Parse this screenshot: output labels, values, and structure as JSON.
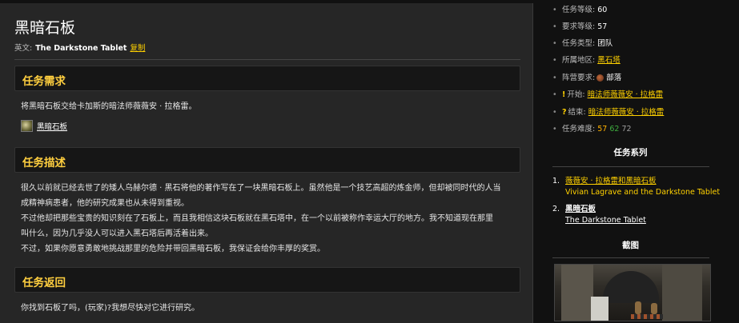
{
  "main": {
    "title": "黑暗石板",
    "en_label": "英文:",
    "en_name": "The Darkstone Tablet",
    "copy_label": "复制",
    "sections": {
      "requirements": {
        "heading": "任务需求",
        "text": "将黑暗石板交给卡加斯的暗法师薇薇安 · 拉格雷。",
        "item_label": "黑暗石板"
      },
      "description": {
        "heading": "任务描述",
        "lines": [
          "很久以前就已经去世了的矮人乌赫尔德 · 黑石将他的著作写在了一块黑暗石板上。虽然他是一个技艺高超的炼金师，但却被同时代的人当",
          "成精神病患者，他的研究成果也从未得到重视。",
          "不过他却把那些宝贵的知识刻在了石板上，而且我相信这块石板就在黑石塔中，在一个以前被称作幸运大厅的地方。我不知道现在那里",
          "叫什么，因为几乎没人可以进入黑石塔后再活着出来。",
          "不过，如果你愿意勇敢地挑战那里的危险并带回黑暗石板，我保证会给你丰厚的奖赏。"
        ]
      },
      "return": {
        "heading": "任务返回",
        "text": "你找到石板了吗，(玩家)?我想尽快对它进行研究。"
      }
    }
  },
  "sidebar": {
    "info": [
      {
        "label": "任务等级:",
        "value": "60"
      },
      {
        "label": "要求等级:",
        "value": "57"
      },
      {
        "label": "任务类型:",
        "value": "团队"
      },
      {
        "label": "所属地区:",
        "value": "黑石塔"
      },
      {
        "label": "阵营要求:",
        "value": "部落"
      },
      {
        "label": "开始:",
        "value": "暗法师薇薇安 · 拉格雷"
      },
      {
        "label": "结束:",
        "value": "暗法师薇薇安 · 拉格雷"
      },
      {
        "label": "任务难度:",
        "d1": "57",
        "d2": "62",
        "d3": "72"
      }
    ],
    "series_heading": "任务系列",
    "series": [
      {
        "num": "1.",
        "cn": "薇薇安 · 拉格雷和黑暗石板",
        "en": "Vivian Lagrave and the Darkstone Tablet"
      },
      {
        "num": "2.",
        "cn": "黑暗石板",
        "en": "The Darkstone Tablet"
      }
    ],
    "screenshot_heading": "截图"
  },
  "colors": {
    "accent": "#ffd100",
    "heading": "#ffcf3f",
    "panel": "#262626",
    "background": "#111111"
  }
}
